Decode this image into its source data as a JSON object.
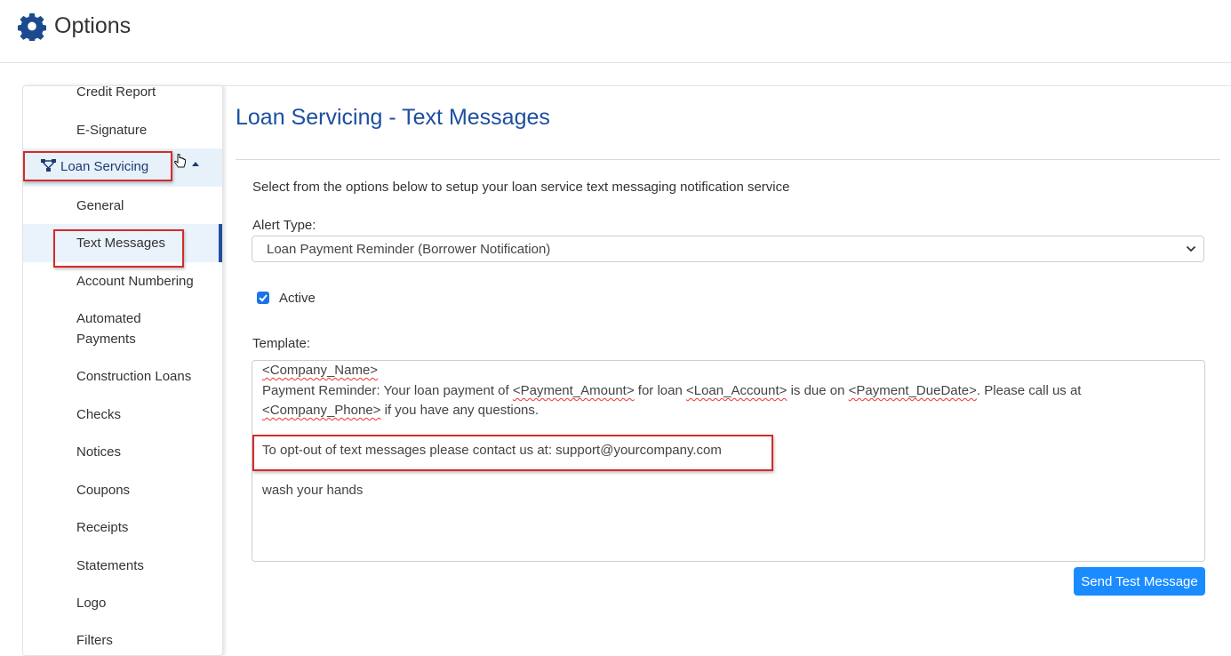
{
  "header": {
    "title": "Options"
  },
  "sidebar": {
    "items": [
      {
        "label": "Credit Report"
      },
      {
        "label": "E-Signature"
      },
      {
        "label": "Loan Servicing"
      },
      {
        "label": "General"
      },
      {
        "label": "Text Messages"
      },
      {
        "label": "Account Numbering"
      },
      {
        "label": "Automated"
      },
      {
        "label": "Payments"
      },
      {
        "label": "Construction Loans"
      },
      {
        "label": "Checks"
      },
      {
        "label": "Notices"
      },
      {
        "label": "Coupons"
      },
      {
        "label": "Receipts"
      },
      {
        "label": "Statements"
      },
      {
        "label": "Logo"
      },
      {
        "label": "Filters"
      }
    ]
  },
  "main": {
    "title": "Loan Servicing - Text Messages",
    "intro": "Select from the options below to setup your loan service text messaging notification service",
    "alert_type": {
      "label": "Alert Type:",
      "value": "Loan Payment Reminder (Borrower Notification)"
    },
    "active": {
      "label": "Active",
      "checked": true
    },
    "template": {
      "label": "Template:",
      "tokens": {
        "company_name": "<Company_Name>",
        "payment_amount": "<Payment_Amount>",
        "loan_account": "<Loan_Account>",
        "payment_duedate": "<Payment_DueDate>",
        "company_phone": "<Company_Phone>"
      },
      "text": {
        "reminder_prefix": "Payment Reminder: Your loan payment of ",
        "for_loan": " for loan ",
        "is_due_on": " is due on ",
        "call_us": ". Please call us at",
        "questions": " if you have any questions.",
        "opt_out": "To opt-out of text messages please contact us at: support@yourcompany.com",
        "wash": "wash your hands"
      }
    },
    "send_button": "Send Test Message"
  },
  "colors": {
    "accent": "#1c4fa0",
    "button": "#1a8cff",
    "highlight": "#d62a2a"
  }
}
